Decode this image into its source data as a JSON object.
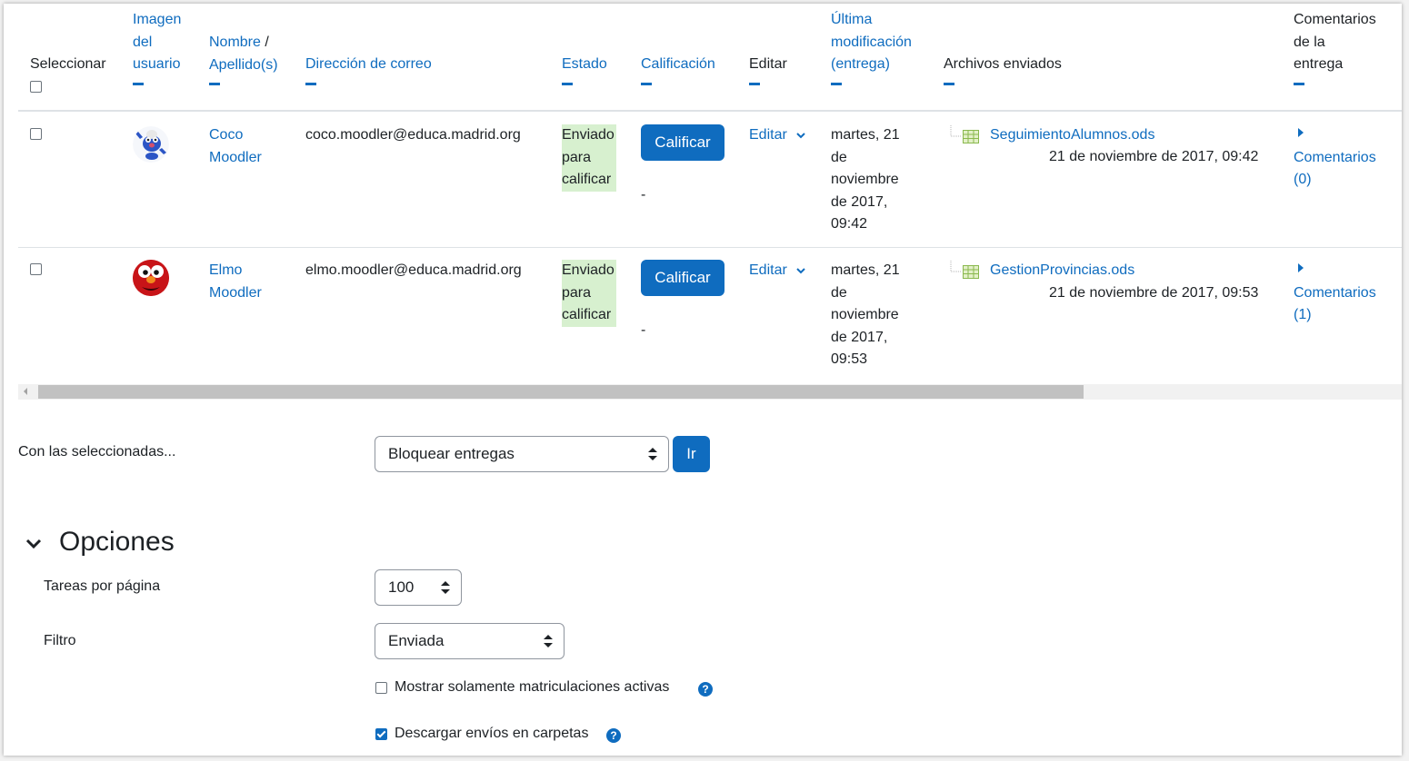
{
  "table": {
    "headers": {
      "select": "Seleccionar",
      "user_picture": [
        "Imagen",
        "del",
        "usuario"
      ],
      "name_first": "Nombre",
      "name_sep": " /",
      "name_last": "Apellido(s)",
      "email": "Dirección de correo",
      "status": "Estado",
      "grade": "Calificación",
      "edit": "Editar",
      "last_modified": [
        "Última",
        "modificación",
        "(entrega)"
      ],
      "files": "Archivos enviados",
      "comments": [
        "Comentarios",
        "de la",
        "entrega"
      ]
    },
    "rows": [
      {
        "first_name": "Coco",
        "last_name": "Moodler",
        "email": "coco.moodler@educa.madrid.org",
        "status": [
          "Enviado",
          "para",
          "calificar"
        ],
        "grade_button": "Calificar",
        "grade_value": "-",
        "edit": "Editar",
        "modified": [
          "martes, 21",
          "de",
          "noviembre",
          "de 2017,",
          "09:42"
        ],
        "file_name": "SeguimientoAlumnos.ods",
        "file_date": "21 de noviembre de 2017, 09:42",
        "comments_label": "Comentarios",
        "comments_count": "(0)"
      },
      {
        "first_name": "Elmo",
        "last_name": "Moodler",
        "email": "elmo.moodler@educa.madrid.org",
        "status": [
          "Enviado",
          "para",
          "calificar"
        ],
        "grade_button": "Calificar",
        "grade_value": "-",
        "edit": "Editar",
        "modified": [
          "martes, 21",
          "de",
          "noviembre",
          "de 2017,",
          "09:53"
        ],
        "file_name": "GestionProvincias.ods",
        "file_date": "21 de noviembre de 2017, 09:53",
        "comments_label": "Comentarios",
        "comments_count": "(1)"
      }
    ]
  },
  "bulk": {
    "label": "Con las seleccionadas...",
    "selected": "Bloquear entregas",
    "go": "Ir"
  },
  "options": {
    "title": "Opciones",
    "per_page_label": "Tareas por página",
    "per_page_value": "100",
    "filter_label": "Filtro",
    "filter_value": "Enviada",
    "active_only_label": "Mostrar solamente matriculaciones activas",
    "active_only_checked": false,
    "download_folders_label": "Descargar envíos en carpetas",
    "download_folders_checked": true
  },
  "colors": {
    "primary": "#0f6cbf",
    "status_bg": "#d7f0cf"
  }
}
